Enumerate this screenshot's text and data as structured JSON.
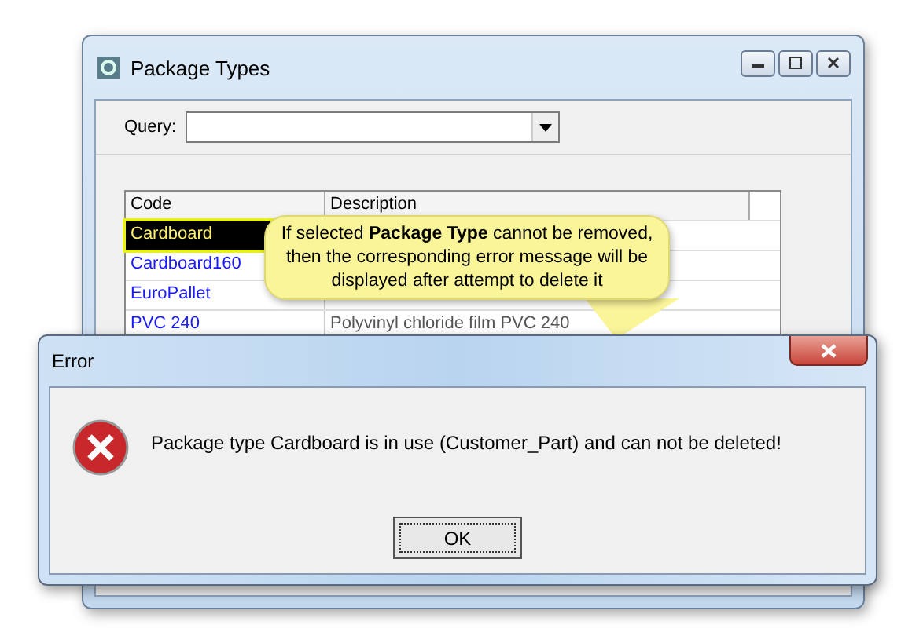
{
  "main_window": {
    "title": "Package Types",
    "query": {
      "label": "Query:"
    },
    "table": {
      "columns": [
        "Code",
        "Description"
      ],
      "rows": [
        {
          "code": "Cardboard",
          "selected": true
        },
        {
          "code": "Cardboard160",
          "selected": false
        },
        {
          "code": "EuroPallet",
          "selected": false
        },
        {
          "code": "PVC 240",
          "description": "Polyvinyl chloride film PVC 240",
          "selected": false
        }
      ]
    }
  },
  "callout": {
    "text": "If selected **Package Type** cannot be removed, then the corresponding error message will be displayed after attempt to delete it"
  },
  "error_dialog": {
    "title": "Error",
    "message": "Package type Cardboard is in use (Customer_Part) and can not be deleted!",
    "button": "OK"
  }
}
